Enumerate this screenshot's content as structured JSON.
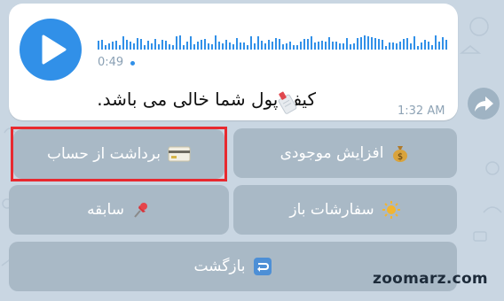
{
  "message": {
    "voice": {
      "duration": "0:49",
      "play_icon": "play-icon"
    },
    "text": "کیف پول شما خالی می باشد.",
    "time": "1:32 AM"
  },
  "keyboard": {
    "deposit": {
      "label": "افزایش موجودی",
      "icon": "money-bag-icon"
    },
    "withdraw": {
      "label": "برداشت از حساب",
      "icon": "credit-card-icon"
    },
    "open_orders": {
      "label": "سفارشات باز",
      "icon": "sun-icon"
    },
    "history": {
      "label": "سابقه",
      "icon": "pushpin-icon"
    },
    "back": {
      "label": "بازگشت",
      "icon": "return-arrow-icon"
    }
  },
  "watermark": "zoomarz.com",
  "colors": {
    "accent": "#3190e8",
    "highlight": "#e8292f",
    "button_bg": "#a9b9c6",
    "chat_bg": "#c9d6e2"
  }
}
